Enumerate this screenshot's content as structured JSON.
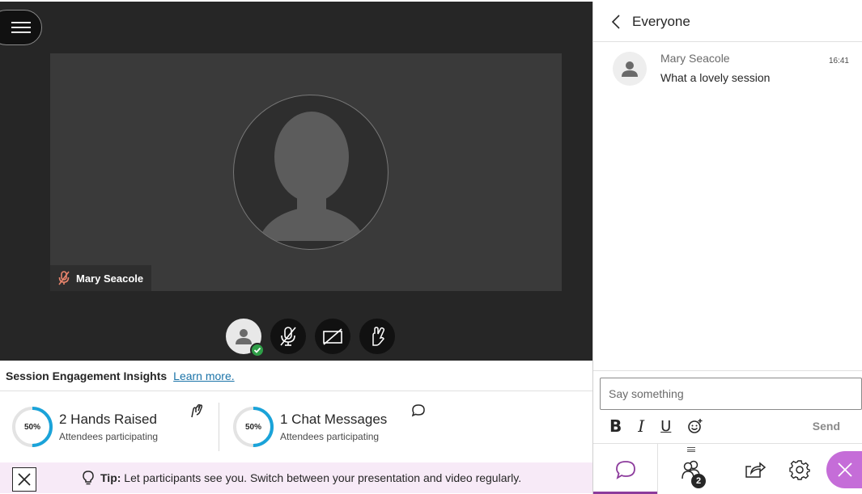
{
  "stage": {
    "participant_name": "Mary Seacole"
  },
  "insights": {
    "title": "Session Engagement Insights",
    "learn_more": "Learn more.",
    "metrics": [
      {
        "percent_label": "50%",
        "percent": 50,
        "value": "2 Hands Raised",
        "sub": "Attendees participating",
        "icon": "hand-raised-icon"
      },
      {
        "percent_label": "50%",
        "percent": 50,
        "value": "1 Chat Messages",
        "sub": "Attendees participating",
        "icon": "chat-bubble-icon"
      }
    ]
  },
  "tip": {
    "label": "Tip:",
    "text": "Let participants see you. Switch between your presentation and video regularly."
  },
  "chat": {
    "title": "Everyone",
    "messages": [
      {
        "author": "Mary Seacole",
        "time": "16:41",
        "text": "What a lovely session"
      }
    ],
    "composer_placeholder": "Say something",
    "format": {
      "bold": "B",
      "italic": "I",
      "underline": "U"
    },
    "send_label": "Send",
    "people_count": "2"
  },
  "colors": {
    "accent_purple": "#8c3b9c",
    "close_pink": "#c56dd8",
    "ring_blue": "#1aa3d9",
    "status_green": "#2e9e47",
    "tip_background": "#f7eaf7"
  }
}
